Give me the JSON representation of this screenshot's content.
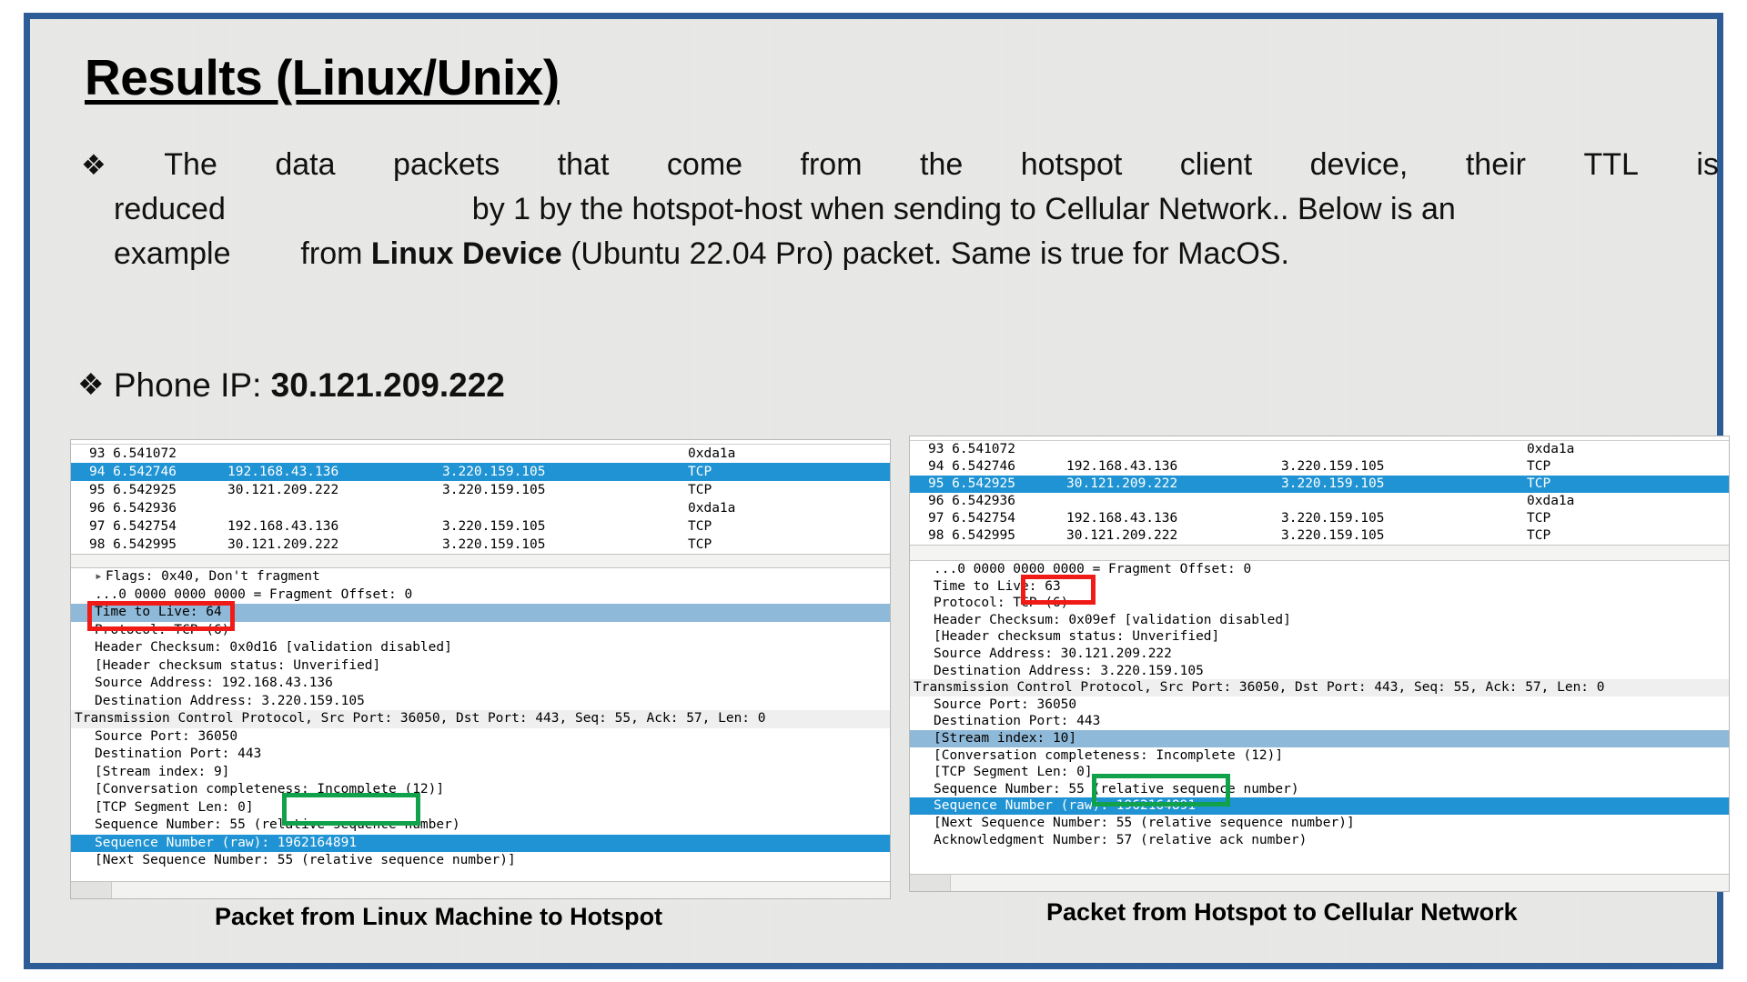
{
  "slide": {
    "title": "Results (Linux/Unix)",
    "accent_color": "#2e5c97",
    "background_color": "#eeeeec"
  },
  "bullets": [
    {
      "marker": "❖",
      "line1": "The   data   packets   that   come   from   the   hotspot   client   device,   their   TTL   is",
      "line1_words": [
        "The",
        "data",
        "packets",
        "that",
        "come",
        "from",
        "the",
        "hotspot",
        "client",
        "device,",
        "their",
        "TTL",
        "is"
      ],
      "line2_a": "reduced",
      "line2_b": "by 1 by the hotspot-host when sending to Cellular Network.. Below is an",
      "line3_a": "example",
      "line3_b": "from ",
      "line3_bold": "Linux Device",
      "line3_c": " (Ubuntu 22.04 Pro) packet. Same is true for MacOS."
    },
    {
      "marker": "❖",
      "label": "Phone IP: ",
      "value": "30.121.209.222"
    }
  ],
  "captions": {
    "left": "Packet from Linux Machine to Hotspot",
    "right": "Packet from Hotspot to Cellular Network"
  },
  "highlight_colors": {
    "ttl_box": "#f01b16",
    "seq_box": "#12a14b",
    "selected_row": "#1f93d3",
    "selected_field": "#8fb9d8"
  },
  "left_pane": {
    "packet_list": [
      {
        "no": "93",
        "time": "6.541072",
        "src": "",
        "dst": "",
        "proto": "0xda1a",
        "selected": false
      },
      {
        "no": "94",
        "time": "6.542746",
        "src": "192.168.43.136",
        "dst": "3.220.159.105",
        "proto": "TCP",
        "selected": true
      },
      {
        "no": "95",
        "time": "6.542925",
        "src": "30.121.209.222",
        "dst": "3.220.159.105",
        "proto": "TCP",
        "selected": false
      },
      {
        "no": "96",
        "time": "6.542936",
        "src": "",
        "dst": "",
        "proto": "0xda1a",
        "selected": false
      },
      {
        "no": "97",
        "time": "6.542754",
        "src": "192.168.43.136",
        "dst": "3.220.159.105",
        "proto": "TCP",
        "selected": false
      },
      {
        "no": "98",
        "time": "6.542995",
        "src": "30.121.209.222",
        "dst": "3.220.159.105",
        "proto": "TCP",
        "selected": false
      }
    ],
    "detail": [
      {
        "text": "Flags: 0x40, Don't fragment",
        "indent": 1,
        "arrow": true,
        "style": "none"
      },
      {
        "text": "...0 0000 0000 0000 = Fragment Offset: 0",
        "indent": 1,
        "arrow": false,
        "style": "none"
      },
      {
        "text": "Time to Live: 64",
        "indent": 1,
        "arrow": false,
        "style": "sel-light"
      },
      {
        "text": "Protocol: TCP (6)",
        "indent": 1,
        "arrow": false,
        "style": "none"
      },
      {
        "text": "Header Checksum: 0x0d16 [validation disabled]",
        "indent": 1,
        "arrow": false,
        "style": "none"
      },
      {
        "text": "[Header checksum status: Unverified]",
        "indent": 1,
        "arrow": false,
        "style": "none"
      },
      {
        "text": "Source Address: 192.168.43.136",
        "indent": 1,
        "arrow": false,
        "style": "none"
      },
      {
        "text": "Destination Address: 3.220.159.105",
        "indent": 1,
        "arrow": false,
        "style": "none"
      },
      {
        "text": "Transmission Control Protocol, Src Port: 36050, Dst Port: 443, Seq: 55, Ack: 57, Len: 0",
        "indent": 0,
        "arrow": false,
        "style": "sel-grey"
      },
      {
        "text": "Source Port: 36050",
        "indent": 1,
        "arrow": false,
        "style": "none"
      },
      {
        "text": "Destination Port: 443",
        "indent": 1,
        "arrow": false,
        "style": "none"
      },
      {
        "text": "[Stream index: 9]",
        "indent": 1,
        "arrow": false,
        "style": "none"
      },
      {
        "text": "[Conversation completeness: Incomplete (12)]",
        "indent": 1,
        "arrow": false,
        "style": "none"
      },
      {
        "text": "[TCP Segment Len: 0]",
        "indent": 1,
        "arrow": false,
        "style": "none"
      },
      {
        "text": "Sequence Number: 55    (relative sequence number)",
        "indent": 1,
        "arrow": false,
        "style": "none"
      },
      {
        "text": "Sequence Number (raw): 1962164891",
        "indent": 1,
        "arrow": false,
        "style": "sel-strong"
      },
      {
        "text": "[Next Sequence Number: 55    (relative sequence number)]",
        "indent": 1,
        "arrow": false,
        "style": "none"
      }
    ],
    "ttl_value": "64",
    "seq_raw_value": "1962164891"
  },
  "right_pane": {
    "packet_list": [
      {
        "no": "93",
        "time": "6.541072",
        "src": "",
        "dst": "",
        "proto": "0xda1a",
        "selected": false
      },
      {
        "no": "94",
        "time": "6.542746",
        "src": "192.168.43.136",
        "dst": "3.220.159.105",
        "proto": "TCP",
        "selected": false
      },
      {
        "no": "95",
        "time": "6.542925",
        "src": "30.121.209.222",
        "dst": "3.220.159.105",
        "proto": "TCP",
        "selected": true
      },
      {
        "no": "96",
        "time": "6.542936",
        "src": "",
        "dst": "",
        "proto": "0xda1a",
        "selected": false
      },
      {
        "no": "97",
        "time": "6.542754",
        "src": "192.168.43.136",
        "dst": "3.220.159.105",
        "proto": "TCP",
        "selected": false
      },
      {
        "no": "98",
        "time": "6.542995",
        "src": "30.121.209.222",
        "dst": "3.220.159.105",
        "proto": "TCP",
        "selected": false
      }
    ],
    "detail": [
      {
        "text": "...0 0000 0000 0000 = Fragment Offset: 0",
        "indent": 1,
        "arrow": false,
        "style": "none"
      },
      {
        "text": "Time to Live: 63",
        "indent": 1,
        "arrow": false,
        "style": "none"
      },
      {
        "text": "Protocol: TCP (6)",
        "indent": 1,
        "arrow": false,
        "style": "none"
      },
      {
        "text": "Header Checksum: 0x09ef [validation disabled]",
        "indent": 1,
        "arrow": false,
        "style": "none"
      },
      {
        "text": "[Header checksum status: Unverified]",
        "indent": 1,
        "arrow": false,
        "style": "none"
      },
      {
        "text": "Source Address: 30.121.209.222",
        "indent": 1,
        "arrow": false,
        "style": "none"
      },
      {
        "text": "Destination Address: 3.220.159.105",
        "indent": 1,
        "arrow": false,
        "style": "none"
      },
      {
        "text": "Transmission Control Protocol, Src Port: 36050, Dst Port: 443, Seq: 55, Ack: 57, Len: 0",
        "indent": 0,
        "arrow": false,
        "style": "sel-grey"
      },
      {
        "text": "Source Port: 36050",
        "indent": 1,
        "arrow": false,
        "style": "none"
      },
      {
        "text": "Destination Port: 443",
        "indent": 1,
        "arrow": false,
        "style": "none"
      },
      {
        "text": "[Stream index: 10]",
        "indent": 1,
        "arrow": false,
        "style": "sel-light"
      },
      {
        "text": "[Conversation completeness: Incomplete (12)]",
        "indent": 1,
        "arrow": false,
        "style": "none"
      },
      {
        "text": "[TCP Segment Len: 0]",
        "indent": 1,
        "arrow": false,
        "style": "none"
      },
      {
        "text": "Sequence Number: 55    (relative sequence number)",
        "indent": 1,
        "arrow": false,
        "style": "none"
      },
      {
        "text": "Sequence Number (raw): 1962164891",
        "indent": 1,
        "arrow": false,
        "style": "sel-strong"
      },
      {
        "text": "[Next Sequence Number: 55    (relative sequence number)]",
        "indent": 1,
        "arrow": false,
        "style": "none"
      },
      {
        "text": "Acknowledgment Number: 57    (relative ack number)",
        "indent": 1,
        "arrow": false,
        "style": "none"
      }
    ],
    "ttl_value": "63",
    "seq_raw_value": "1962164891"
  }
}
